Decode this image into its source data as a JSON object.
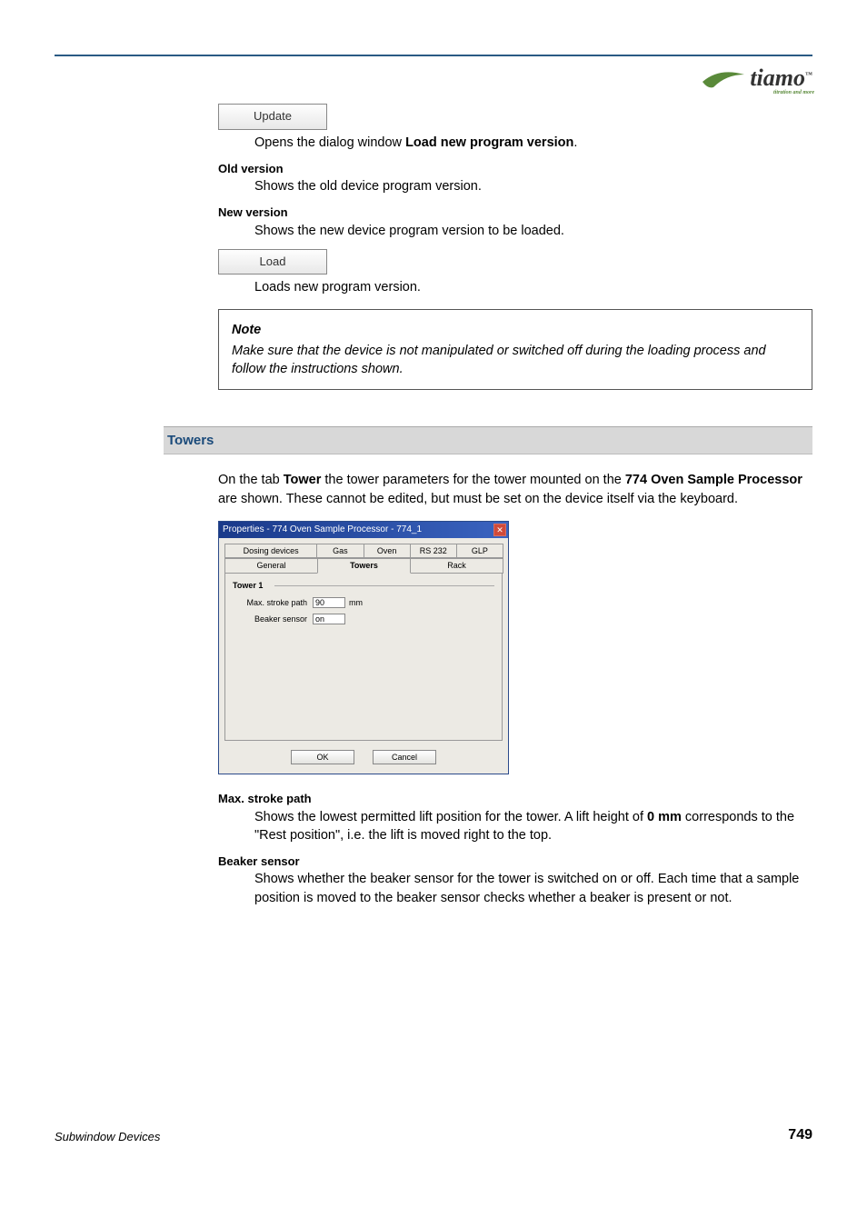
{
  "logo": {
    "brand": "tiamo",
    "tm": "™",
    "tagline": "titration and more"
  },
  "buttons": {
    "update": "Update",
    "load": "Load"
  },
  "updateDesc": {
    "prefix": "Opens the dialog window ",
    "bold": "Load new program version",
    "suffix": "."
  },
  "oldVersion": {
    "label": "Old version",
    "desc": "Shows the old device program version."
  },
  "newVersion": {
    "label": "New version",
    "desc": "Shows the new device program version to be loaded."
  },
  "loadDesc": "Loads new program version.",
  "note": {
    "title": "Note",
    "body": "Make sure that the device is not manipulated or switched off during the loading process and follow the instructions shown."
  },
  "section": {
    "towers": "Towers"
  },
  "towersIntro": {
    "p1a": "On the tab ",
    "p1b": "Tower",
    "p1c": " the tower parameters for the tower mounted on the ",
    "p1d": "774 Oven Sample Processor",
    "p1e": " are shown. These cannot be edited, but must be set on the device itself via the keyboard."
  },
  "dialog": {
    "title": "Properties - 774 Oven Sample Processor - 774_1",
    "tabsRow1": [
      "Dosing devices",
      "Gas",
      "Oven",
      "RS 232",
      "GLP"
    ],
    "tabsRow2": [
      "General",
      "Towers",
      "Rack"
    ],
    "activeTab": "Towers",
    "group": "Tower 1",
    "fields": {
      "maxStroke": {
        "label": "Max. stroke path",
        "value": "90",
        "unit": "mm"
      },
      "beaker": {
        "label": "Beaker sensor",
        "value": "on"
      }
    },
    "ok": "OK",
    "cancel": "Cancel"
  },
  "maxStroke": {
    "label": "Max. stroke path",
    "desc1": "Shows the lowest permitted lift position for the tower. A lift height of ",
    "bold": "0 mm",
    "desc2": " corresponds to the \"Rest position\", i.e. the lift is moved right to the top."
  },
  "beakerSensor": {
    "label": "Beaker sensor",
    "desc": "Shows whether the beaker sensor for the tower is switched on or off. Each time that a sample position is moved to the beaker sensor checks whether a beaker is present or not."
  },
  "footer": {
    "left": "Subwindow Devices",
    "right": "749"
  }
}
